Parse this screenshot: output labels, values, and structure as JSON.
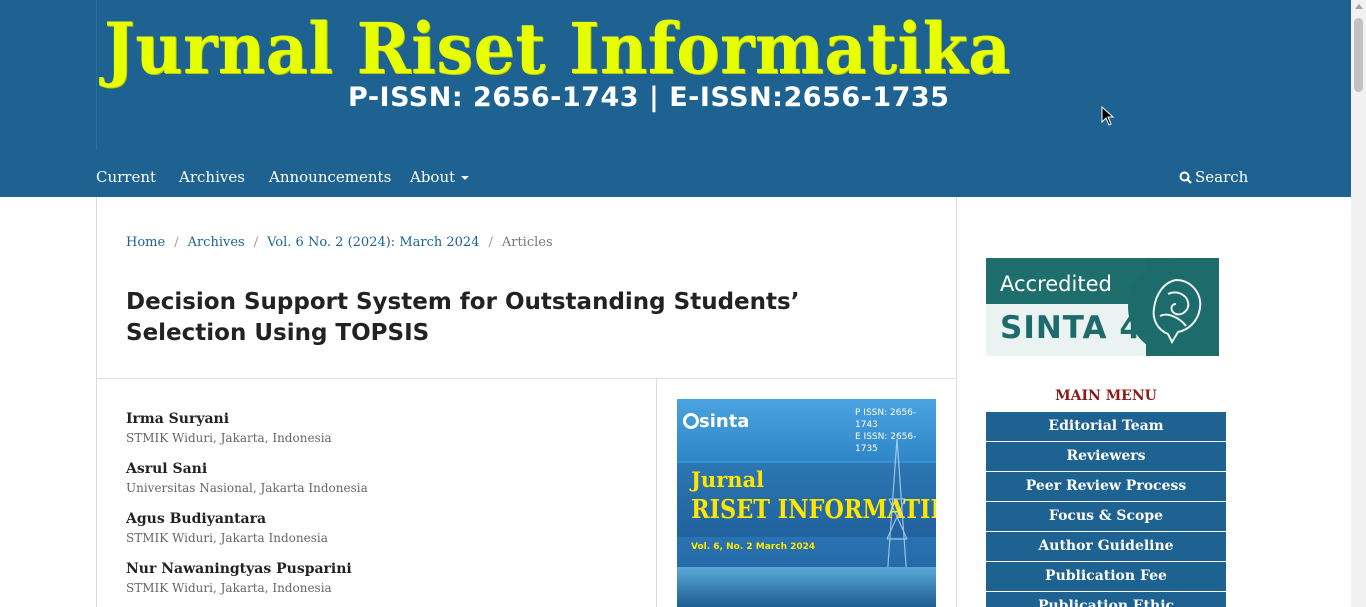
{
  "header": {
    "logo_title": "Jurnal Riset Informatika",
    "logo_issn": "P-ISSN: 2656-1743 | E-ISSN:2656-1735"
  },
  "nav": {
    "items": [
      "Current",
      "Archives",
      "Announcements",
      "About"
    ],
    "search": "Search"
  },
  "breadcrumb": {
    "home": "Home",
    "archives": "Archives",
    "issue": "Vol. 6 No. 2 (2024): March 2024",
    "current": "Articles"
  },
  "article": {
    "title": "Decision Support System for Outstanding Students’ Selection Using TOPSIS",
    "authors": [
      {
        "name": "Irma Suryani",
        "affiliation": "STMIK Widuri, Jakarta, Indonesia"
      },
      {
        "name": "Asrul Sani",
        "affiliation": "Universitas Nasional, Jakarta Indonesia"
      },
      {
        "name": "Agus Budiyantara",
        "affiliation": "STMIK Widuri, Jakarta Indonesia"
      },
      {
        "name": "Nur Nawaningtyas Pusparini",
        "affiliation": "STMIK Widuri, Jakarta, Indonesia"
      }
    ]
  },
  "cover": {
    "sinta": "sinta",
    "issn_p": "P ISSN: 2656-1743",
    "issn_e": "E ISSN: 2656-1735",
    "jurnal": "Jurnal",
    "riset": "RISET INFORMATIKA",
    "volume": "Vol. 6, No. 2 March 2024"
  },
  "sidebar": {
    "badge_accredited": "Accredited",
    "badge_sinta": "SINTA 4",
    "menu_title": "MAIN MENU",
    "menu_items": [
      "Editorial Team",
      "Reviewers",
      "Peer Review Process",
      "Focus & Scope",
      "Author Guideline",
      "Publication Fee",
      "Publication Ethic"
    ]
  },
  "colors": {
    "header_bg": "#1e6292",
    "logo_yellow": "#e8ff00",
    "menu_title": "#8b1a1a",
    "link": "#1e6292"
  }
}
